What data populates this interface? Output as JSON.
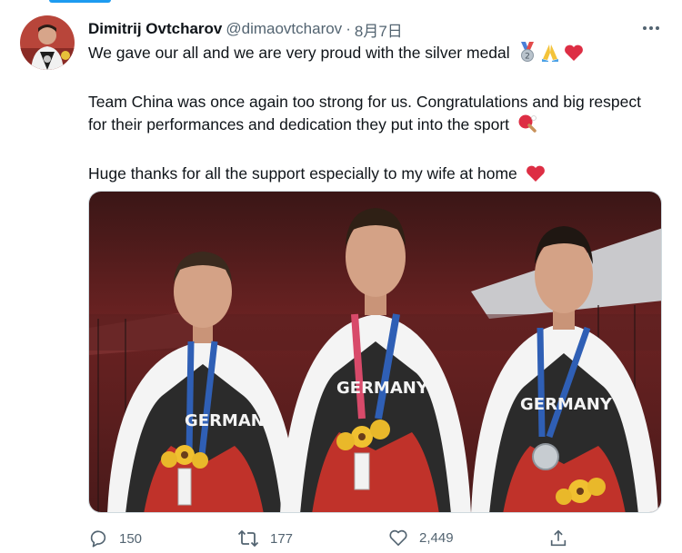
{
  "tweet": {
    "author": {
      "display_name": "Dimitrij Ovtcharov",
      "handle": "@dimaovtcharov"
    },
    "separator": "·",
    "date": "8月7日",
    "paragraphs": [
      "We gave our all and we are very proud with the silver medal",
      "Team China was once again too strong for us. Congratulations and big respect for their performances and dedication they put into the sport",
      "Huge thanks for all the support especially to my wife at home"
    ],
    "emojis": {
      "paragraph_1": [
        "2nd-place-medal-icon",
        "folded-hands-icon",
        "red-heart-icon"
      ],
      "paragraph_2": [
        "ping-pong-icon"
      ],
      "paragraph_3": [
        "red-heart-icon"
      ]
    },
    "photo": {
      "jersey_text": "GERMANY",
      "description_icon": "photo-three-medalists"
    },
    "metrics": {
      "replies": "150",
      "retweets": "177",
      "likes": "2,449"
    }
  },
  "icons": {
    "reply": "speech-bubble-icon",
    "retweet": "retweet-arrows-icon",
    "like": "heart-outline-icon",
    "share": "share-upload-icon",
    "more": "more-dots-icon"
  },
  "colors": {
    "accent": "#1d9bf0",
    "text": "#0f1419",
    "secondary": "#536471",
    "heart": "#e0245e"
  }
}
